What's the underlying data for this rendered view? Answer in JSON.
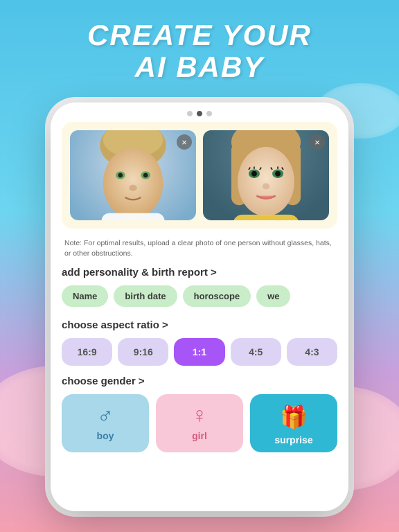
{
  "header": {
    "title_line1": "CREATE YOUR",
    "title_line2": "AI BABY"
  },
  "dots": [
    {
      "active": false
    },
    {
      "active": true
    },
    {
      "active": false
    }
  ],
  "photo_section": {
    "note": "Note: For optimal results, upload a clear photo of one person without glasses, hats, or other obstructions.",
    "close_label": "×"
  },
  "personality_section": {
    "label": "add personality & birth report >",
    "tags": [
      {
        "label": "Name"
      },
      {
        "label": "birth date"
      },
      {
        "label": "horoscope"
      },
      {
        "label": "we"
      }
    ]
  },
  "aspect_section": {
    "label": "choose aspect ratio >",
    "options": [
      {
        "label": "16:9",
        "active": false
      },
      {
        "label": "9:16",
        "active": false
      },
      {
        "label": "1:1",
        "active": true
      },
      {
        "label": "4:5",
        "active": false
      },
      {
        "label": "4:3",
        "active": false
      }
    ]
  },
  "gender_section": {
    "label": "choose gender >",
    "options": [
      {
        "id": "boy",
        "label": "boy",
        "icon": "♂",
        "style": "boy"
      },
      {
        "id": "girl",
        "label": "girl",
        "icon": "♀",
        "style": "girl"
      },
      {
        "id": "surprise",
        "label": "surprise",
        "icon": "🎁",
        "style": "surprise"
      }
    ]
  },
  "colors": {
    "accent_purple": "#a855f7",
    "tag_green": "#c8edc8",
    "boy_blue": "#a8d8ea",
    "girl_pink": "#f9c8d8",
    "surprise_teal": "#2fb8d4"
  }
}
